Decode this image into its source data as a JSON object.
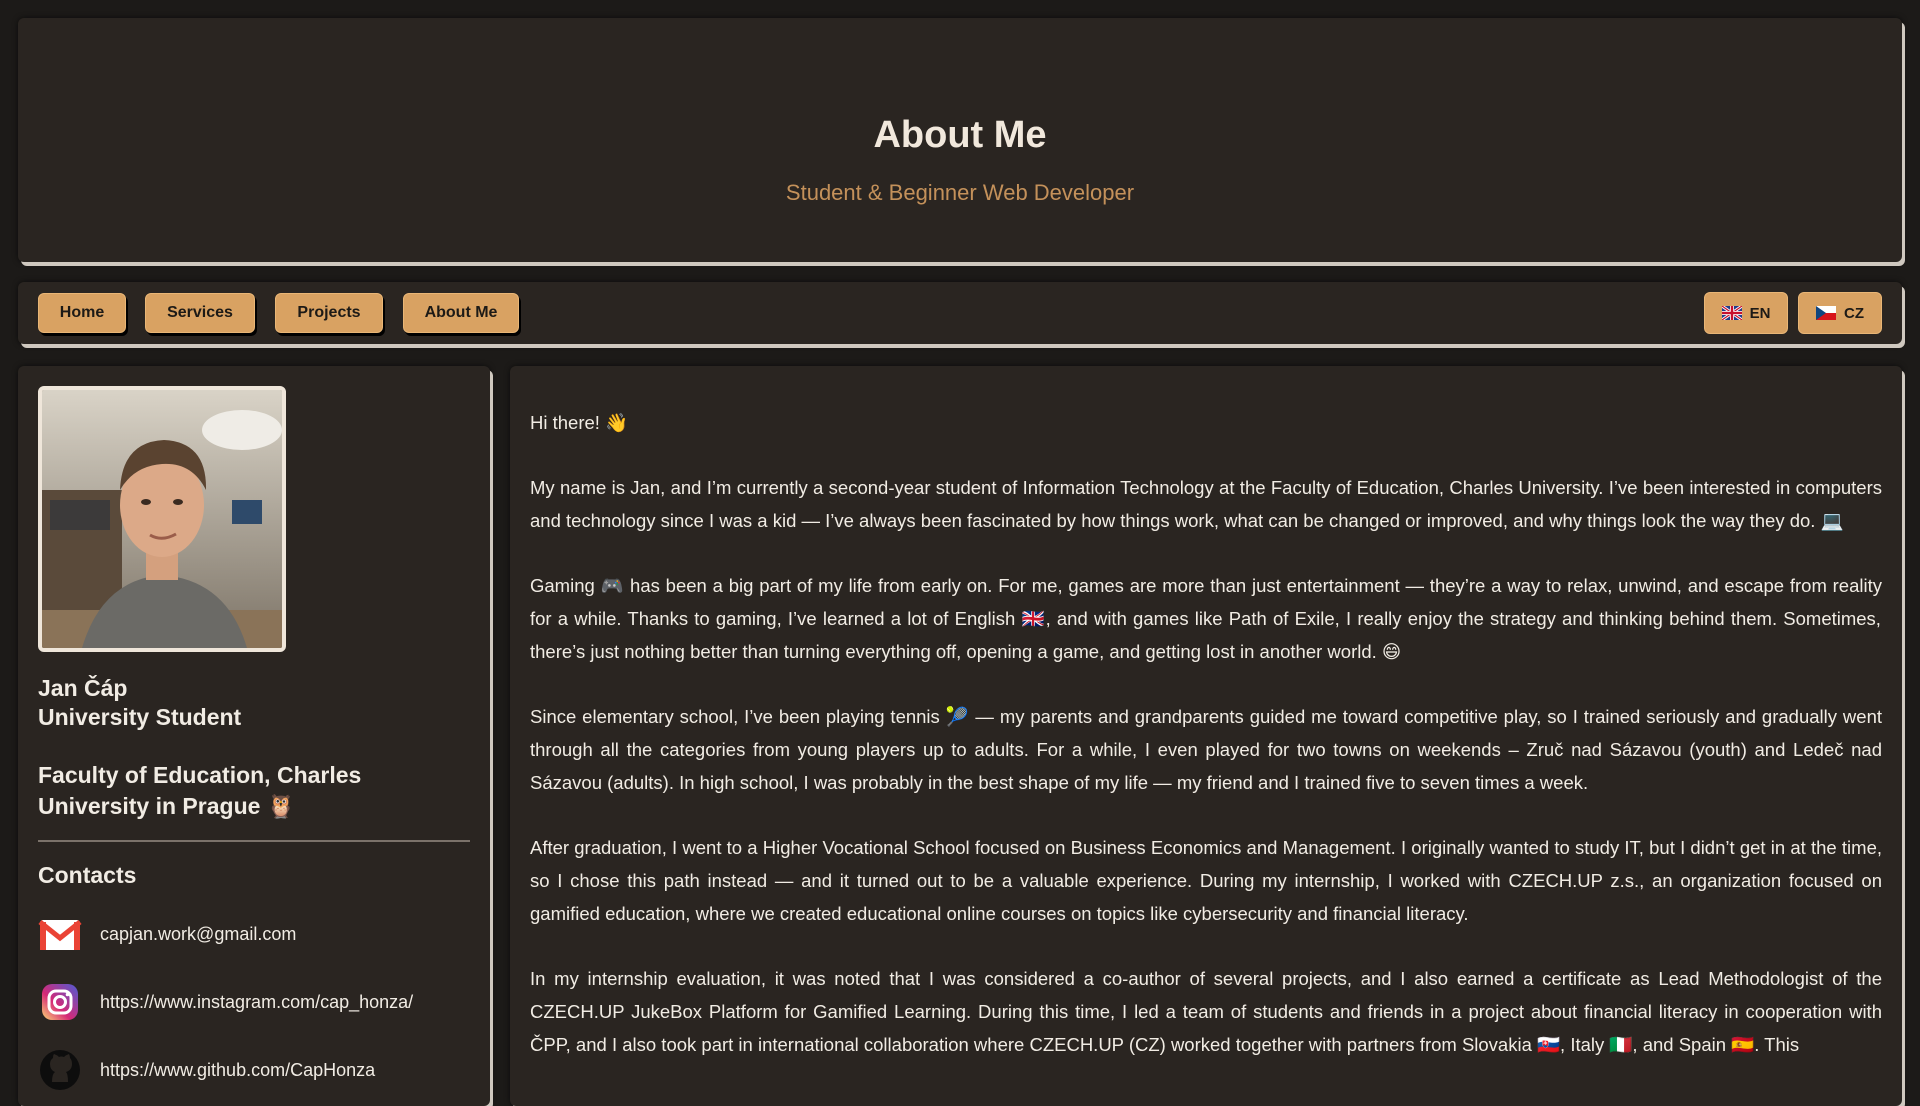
{
  "header": {
    "title": "About Me",
    "subtitle": "Student & Beginner Web Developer"
  },
  "nav": {
    "items": [
      {
        "label": "Home"
      },
      {
        "label": "Services"
      },
      {
        "label": "Projects"
      },
      {
        "label": "About Me"
      }
    ],
    "languages": [
      {
        "label": "EN",
        "flag": "uk-flag-icon"
      },
      {
        "label": "CZ",
        "flag": "czech-flag-icon"
      }
    ]
  },
  "sidebar": {
    "name": "Jan Čáp",
    "role": "University Student",
    "faculty": "Faculty of Education, Charles University in Prague 🦉",
    "contacts_heading": "Contacts",
    "contacts": [
      {
        "icon": "gmail-icon",
        "text": "capjan.work@gmail.com"
      },
      {
        "icon": "instagram-icon",
        "text": "https://www.instagram.com/cap_honza/"
      },
      {
        "icon": "github-icon",
        "text": "https://www.github.com/CapHonza"
      }
    ]
  },
  "content": {
    "paragraphs": [
      "Hi there! 👋",
      "My name is Jan, and I’m currently a second-year student of Information Technology at the Faculty of Education, Charles University. I’ve been interested in computers and technology since I was a kid — I’ve always been fascinated by how things work, what can be changed or improved, and why things look the way they do. 💻",
      "Gaming 🎮 has been a big part of my life from early on. For me, games are more than just entertainment — they’re a way to relax, unwind, and escape from reality for a while. Thanks to gaming, I’ve learned a lot of English 🇬🇧, and with games like Path of Exile, I really enjoy the strategy and thinking behind them. Sometimes, there’s just nothing better than turning everything off, opening a game, and getting lost in another world. 😄",
      "Since elementary school, I’ve been playing tennis 🎾 — my parents and grandparents guided me toward competitive play, so I trained seriously and gradually went through all the categories from young players up to adults. For a while, I even played for two towns on weekends – Zruč nad Sázavou (youth) and Ledeč nad Sázavou (adults). In high school, I was probably in the best shape of my life — my friend and I trained five to seven times a week.",
      "After graduation, I went to a Higher Vocational School focused on Business Economics and Management. I originally wanted to study IT, but I didn’t get in at the time, so I chose this path instead — and it turned out to be a valuable experience. During my internship, I worked with CZECH.UP z.s., an organization focused on gamified education, where we created educational online courses on topics like cybersecurity and financial literacy.",
      "In my internship evaluation, it was noted that I was considered a co-author of several projects, and I also earned a certificate as Lead Methodologist of the CZECH.UP JukeBox Platform for Gamified Learning. During this time, I led a team of students and friends in a project about financial literacy in cooperation with ČPP, and I also took part in international collaboration where CZECH.UP (CZ) worked together with partners from Slovakia 🇸🇰, Italy 🇮🇹, and Spain 🇪🇸. This"
    ]
  }
}
